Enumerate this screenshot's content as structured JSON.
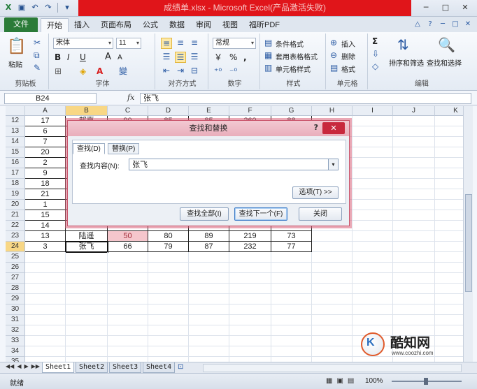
{
  "title_bar": {
    "title": "成绩单.xlsx - Microsoft Excel(产品激活失败)",
    "min": "─",
    "max": "□",
    "close": "✕"
  },
  "tabs": {
    "file": "文件",
    "items": [
      "开始",
      "插入",
      "页面布局",
      "公式",
      "数据",
      "审阅",
      "视图",
      "福昕PDF"
    ]
  },
  "ribbon": {
    "clipboard": {
      "label": "剪贴板",
      "paste": "粘贴"
    },
    "font": {
      "label": "字体",
      "name": "宋体",
      "size": "11",
      "bold": "B",
      "italic": "I",
      "underline": "U",
      "grow": "A",
      "shrink": "A"
    },
    "alignment": {
      "label": "对齐方式"
    },
    "number": {
      "label": "数字",
      "format": "常规",
      "currency": "￥",
      "percent": "%",
      "comma": ","
    },
    "styles": {
      "label": "样式",
      "conditional": "条件格式",
      "table": "套用表格格式",
      "cell": "单元格样式"
    },
    "cells": {
      "label": "单元格",
      "insert": "插入",
      "delete": "删除",
      "format": "格式"
    },
    "editing": {
      "label": "编辑",
      "sort": "排序和筛选",
      "find": "查找和选择"
    }
  },
  "formula_bar": {
    "name_box": "B24",
    "fx": "fx",
    "content": "张飞"
  },
  "grid": {
    "columns": [
      "A",
      "B",
      "C",
      "D",
      "E",
      "F",
      "G",
      "H",
      "I",
      "J",
      "K"
    ],
    "rows": [
      {
        "num": "12",
        "cells": [
          "17",
          "郝嘉",
          "90",
          "85",
          "85",
          "260",
          "88"
        ]
      },
      {
        "num": "13",
        "cells": [
          "6",
          "",
          "",
          "",
          "",
          "",
          ""
        ]
      },
      {
        "num": "14",
        "cells": [
          "7",
          "",
          "",
          "",
          "",
          "",
          ""
        ]
      },
      {
        "num": "15",
        "cells": [
          "20",
          "",
          "",
          "",
          "",
          "",
          ""
        ]
      },
      {
        "num": "16",
        "cells": [
          "2",
          "",
          "",
          "",
          "",
          "",
          ""
        ]
      },
      {
        "num": "17",
        "cells": [
          "9",
          "",
          "",
          "",
          "",
          "",
          ""
        ]
      },
      {
        "num": "18",
        "cells": [
          "18",
          "",
          "",
          "",
          "",
          "",
          ""
        ]
      },
      {
        "num": "19",
        "cells": [
          "21",
          "",
          "",
          "",
          "",
          "",
          ""
        ]
      },
      {
        "num": "20",
        "cells": [
          "1",
          "",
          "",
          "",
          "",
          "",
          ""
        ]
      },
      {
        "num": "21",
        "cells": [
          "15",
          "",
          "",
          "",
          "",
          "",
          ""
        ]
      },
      {
        "num": "22",
        "cells": [
          "14",
          "",
          "",
          "",
          "",
          "",
          ""
        ]
      },
      {
        "num": "23",
        "cells": [
          "13",
          "陆遥",
          "50",
          "80",
          "89",
          "219",
          "73"
        ]
      },
      {
        "num": "24",
        "cells": [
          "3",
          "张飞",
          "66",
          "79",
          "87",
          "232",
          "77"
        ]
      },
      {
        "num": "25",
        "cells": []
      },
      {
        "num": "26",
        "cells": []
      },
      {
        "num": "27",
        "cells": []
      },
      {
        "num": "28",
        "cells": []
      },
      {
        "num": "29",
        "cells": []
      },
      {
        "num": "30",
        "cells": []
      },
      {
        "num": "31",
        "cells": []
      },
      {
        "num": "32",
        "cells": []
      },
      {
        "num": "33",
        "cells": []
      },
      {
        "num": "34",
        "cells": []
      },
      {
        "num": "35",
        "cells": []
      },
      {
        "num": "36",
        "cells": []
      }
    ]
  },
  "sheets": [
    "Sheet1",
    "Sheet2",
    "Sheet3",
    "Sheet4"
  ],
  "status": {
    "ready": "就绪",
    "zoom": "100%"
  },
  "dialog": {
    "title": "查找和替换",
    "help": "?",
    "close": "✕",
    "tab_find": "查找(D)",
    "tab_replace": "替换(P)",
    "find_label": "查找内容(N):",
    "find_value": "张飞",
    "options": "选项(T) >>",
    "find_all": "查找全部(I)",
    "find_next": "查找下一个(F)",
    "close_btn": "关闭"
  },
  "watermark": {
    "name": "酷知网",
    "url": "www.coozhi.com"
  },
  "colors": {
    "title_red": "#e0151a",
    "file_tab": "#2b7b38",
    "dialog_accent": "#c9556c",
    "selected_header": "#f8d785",
    "pink_cell": "#f5c6cc"
  }
}
